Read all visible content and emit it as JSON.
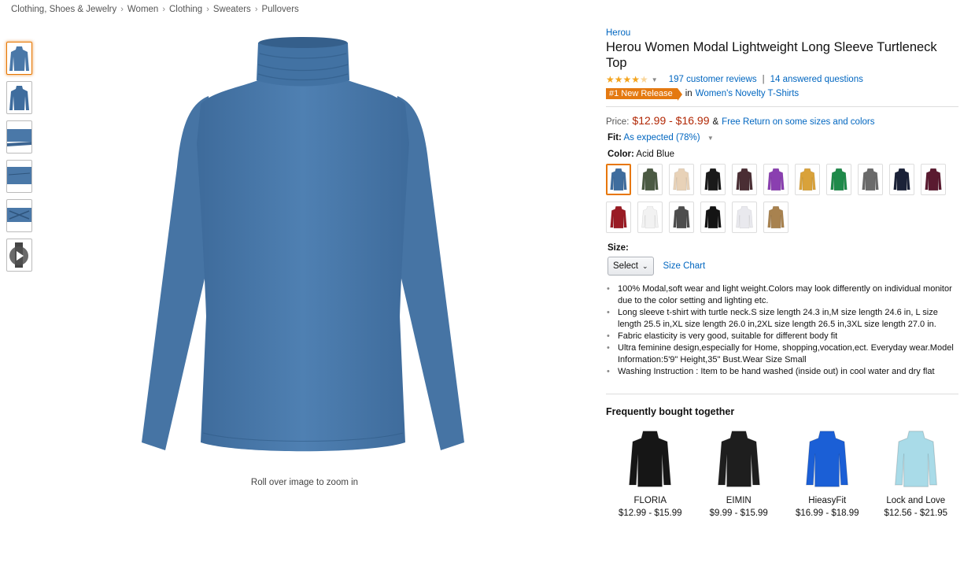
{
  "breadcrumb": [
    "Clothing, Shoes & Jewelry",
    "Women",
    "Clothing",
    "Sweaters",
    "Pullovers"
  ],
  "breadcrumb_separator": "›",
  "main_image": {
    "zoom_hint": "Roll over image to zoom in",
    "color": "#4a78a8"
  },
  "product": {
    "brand": "Herou",
    "title": "Herou Women Modal Lightweight Long Sleeve Turtleneck Top",
    "rating": 4,
    "reviews_link": "197 customer reviews",
    "questions_link": "14 answered questions",
    "badge": "#1 New Release",
    "badge_in": "in",
    "badge_category": "Women's Novelty T-Shirts",
    "price_label": "Price:",
    "price": "$12.99 - $16.99",
    "price_amp": "&",
    "free_return": "Free Return on some sizes and colors",
    "fit_label": "Fit:",
    "fit_value": "As expected (78%)",
    "color_label": "Color:",
    "color_value": "Acid Blue",
    "size_label": "Size:",
    "size_select": "Select",
    "size_chart": "Size Chart",
    "bullets": [
      "100% Modal,soft wear and light weight.Colors may look differently on individual monitor due to the color setting and lighting etc.",
      "Long sleeve t-shirt with turtle neck.S size length 24.3 in,M size length 24.6 in, L size length 25.5 in,XL size length 26.0 in,2XL size length 26.5 in,3XL size length 27.0 in.",
      "Fabric elasticity is very good, suitable for different body fit",
      "Ultra feminine design,especially for Home, shopping,vocation,ect. Everyday wear.Model Information:5'9\" Height,35\" Bust.Wear Size Small",
      "Washing Instruction : Item to be hand washed (inside out) in cool water and dry flat"
    ]
  },
  "swatch_colors": [
    "#3f6d9e",
    "#4b5a43",
    "#e8d2b8",
    "#1a1a1a",
    "#4a2e34",
    "#8a3fb0",
    "#d9a23a",
    "#1f8a4a",
    "#6a6a6a",
    "#1b2238",
    "#5a1a30",
    "#9a1b24",
    "#f2f2f2",
    "#4d4d4d",
    "#141414",
    "#e9e9ee",
    "#a8824f"
  ],
  "thumbnails": [
    "#4a78a8",
    "#4a78a8",
    "#4a78a8",
    "#4a78a8",
    "#4a78a8",
    "#555555"
  ],
  "fbt": {
    "title": "Frequently bought together",
    "items": [
      {
        "name": "FLORIA",
        "price": "$12.99 - $15.99",
        "color": "#161616"
      },
      {
        "name": "EIMIN",
        "price": "$9.99 - $15.99",
        "color": "#1e1e1e"
      },
      {
        "name": "HieasyFit",
        "price": "$16.99 - $18.99",
        "color": "#1b5fd6"
      },
      {
        "name": "Lock and Love",
        "price": "$12.56 - $21.95",
        "color": "#a9dbe8"
      }
    ]
  }
}
